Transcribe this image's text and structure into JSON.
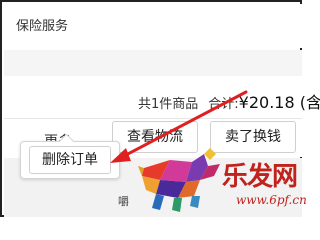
{
  "service": {
    "title": "保险服务"
  },
  "summary": {
    "count_text": "共1件商品",
    "total_label": "合计:",
    "total_value": "¥20.18 (含"
  },
  "actions": {
    "more": "更多",
    "view_logistics": "查看物流",
    "sell_exchange": "卖了换钱"
  },
  "popup": {
    "delete_order": "删除订单"
  },
  "obscured": {
    "text": "嚼"
  },
  "watermark": {
    "title": "乐发网",
    "url": "www.6pf.cn"
  },
  "colors": {
    "arrow": "#e02020",
    "watermark": "#c0221c",
    "separator": "#f5f5f5"
  }
}
